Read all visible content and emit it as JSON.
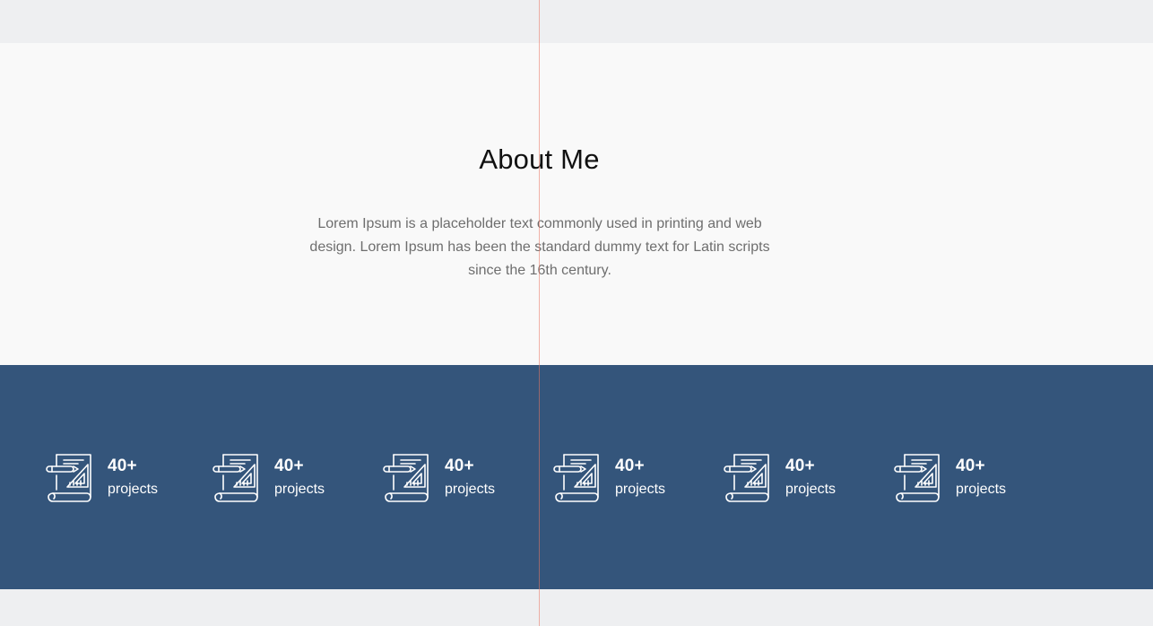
{
  "about": {
    "title": "About Me",
    "text": "Lorem Ipsum is a placeholder text commonly used in printing and web design. Lorem Ipsum has been the standard dummy text for Latin scripts since the 16th century."
  },
  "stats": {
    "items": [
      {
        "icon": "blueprint-icon",
        "number": "40+",
        "label": "projects"
      },
      {
        "icon": "blueprint-icon",
        "number": "40+",
        "label": "projects"
      },
      {
        "icon": "blueprint-icon",
        "number": "40+",
        "label": "projects"
      },
      {
        "icon": "blueprint-icon",
        "number": "40+",
        "label": "projects"
      },
      {
        "icon": "blueprint-icon",
        "number": "40+",
        "label": "projects"
      },
      {
        "icon": "blueprint-icon",
        "number": "40+",
        "label": "projects"
      }
    ]
  },
  "colors": {
    "stats_background": "#34557b",
    "about_background": "#f9f9f9",
    "page_background": "#eeeff1",
    "guide_line": "#e97864"
  }
}
